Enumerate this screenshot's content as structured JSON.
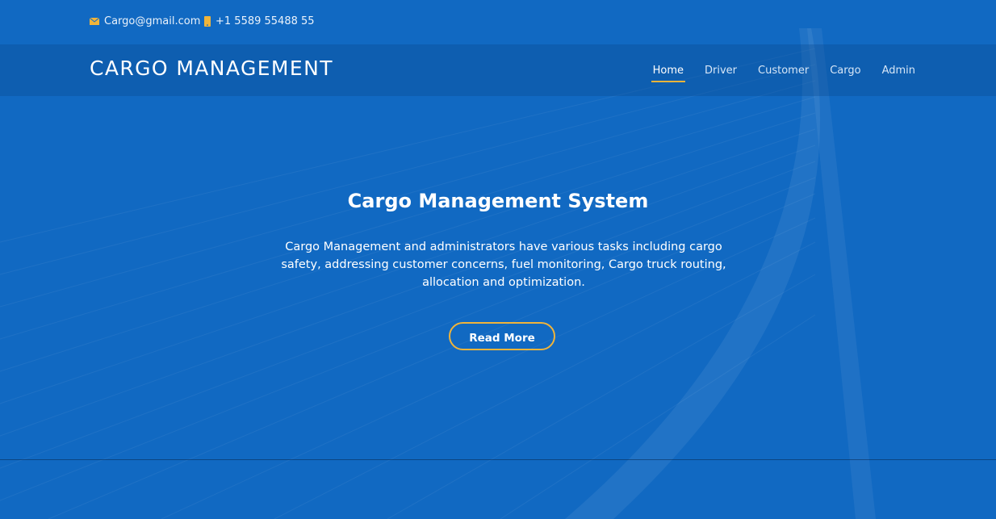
{
  "topbar": {
    "email": "Cargo@gmail.com",
    "phone": "+1 5589 55488 55",
    "email_icon": "mail-icon",
    "phone_icon": "phone-icon"
  },
  "navbar": {
    "brand": "CARGO MANAGEMENT",
    "links": [
      "Home",
      "Driver",
      "Customer",
      "Cargo",
      "Admin"
    ],
    "active": "Home"
  },
  "hero": {
    "title": "Cargo Management System",
    "text": "Cargo Management and administrators have various tasks including cargo safety, addressing customer concerns, fuel monitoring, Cargo truck routing, allocation and optimization.",
    "button": "Read More"
  },
  "colors": {
    "background": "#1169c2",
    "accent": "#f0b43a",
    "text": "#ffffff"
  }
}
